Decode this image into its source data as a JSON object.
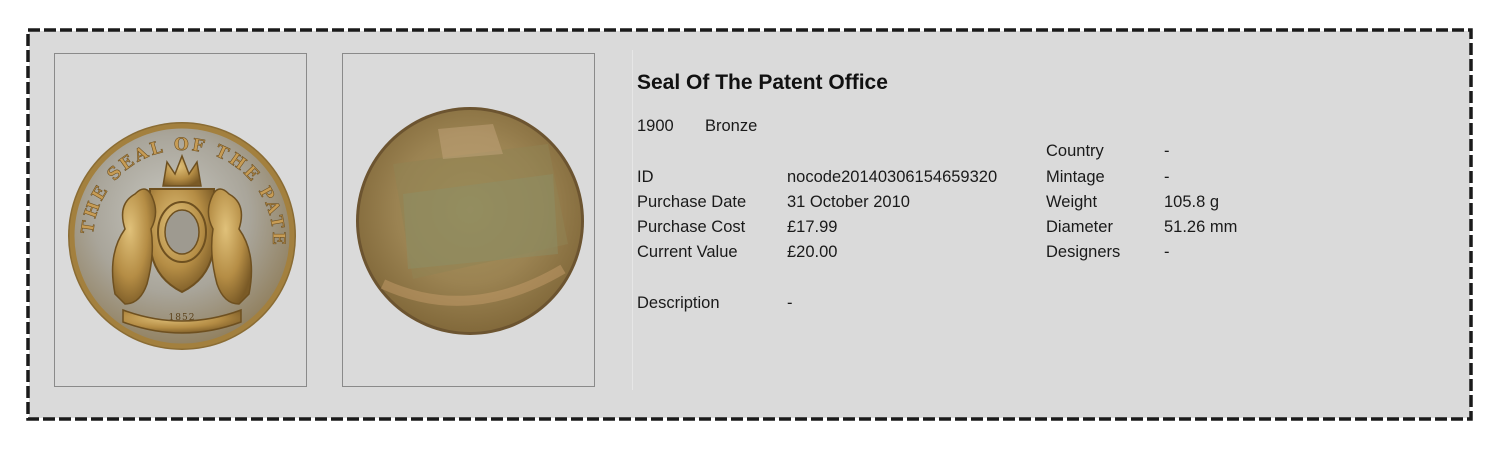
{
  "coin": {
    "title": "Seal Of The Patent Office",
    "year": "1900",
    "composition": "Bronze",
    "obverse_legend": "THE SEAL OF THE PATENT OFFICE",
    "obverse_date": "1852"
  },
  "details_left": [
    {
      "label": "ID",
      "value": "nocode20140306154659320"
    },
    {
      "label": "Purchase Date",
      "value": "31 October 2010"
    },
    {
      "label": "Purchase Cost",
      "value": "£17.99"
    },
    {
      "label": "Current Value",
      "value": "£20.00"
    }
  ],
  "description": {
    "label": "Description",
    "value": "-"
  },
  "details_right": [
    {
      "label": "Country",
      "value": "-"
    },
    {
      "label": "Mintage",
      "value": "-"
    },
    {
      "label": "Weight",
      "value": "105.8 g"
    },
    {
      "label": "Diameter",
      "value": "51.26 mm"
    },
    {
      "label": "Designers",
      "value": "-"
    }
  ],
  "colors": {
    "card_background": "#dadada",
    "border": "#1a1a1a",
    "coin_bronze": "#b0894d"
  }
}
